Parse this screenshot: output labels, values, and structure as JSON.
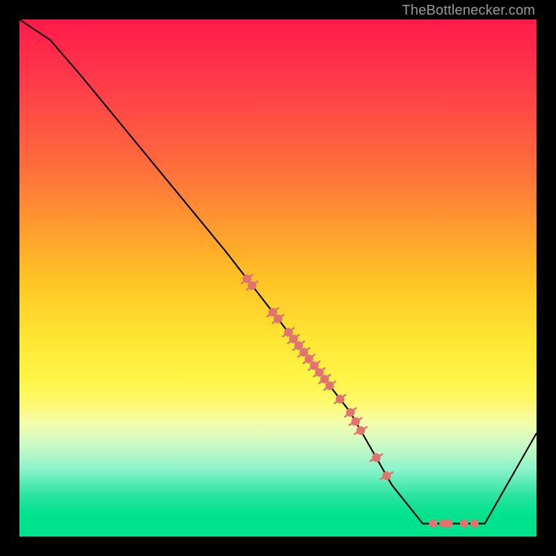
{
  "attribution": "TheBottlenecker.com",
  "chart_data": {
    "type": "line",
    "title": "",
    "xlabel": "",
    "ylabel": "",
    "xlim": [
      0,
      100
    ],
    "ylim": [
      0,
      100
    ],
    "curve": [
      {
        "x": 0,
        "y": 100
      },
      {
        "x": 6,
        "y": 96
      },
      {
        "x": 12,
        "y": 89
      },
      {
        "x": 40,
        "y": 55
      },
      {
        "x": 64,
        "y": 24
      },
      {
        "x": 72,
        "y": 10
      },
      {
        "x": 78,
        "y": 2.5
      },
      {
        "x": 90,
        "y": 2.5
      },
      {
        "x": 100,
        "y": 20
      }
    ],
    "markers_on_slope": [
      {
        "x": 44
      },
      {
        "x": 45
      },
      {
        "x": 49
      },
      {
        "x": 50
      },
      {
        "x": 52
      },
      {
        "x": 53
      },
      {
        "x": 54
      },
      {
        "x": 55
      },
      {
        "x": 56
      },
      {
        "x": 57
      },
      {
        "x": 58
      },
      {
        "x": 59
      },
      {
        "x": 60
      },
      {
        "x": 62
      },
      {
        "x": 64
      },
      {
        "x": 65
      },
      {
        "x": 66
      },
      {
        "x": 69
      },
      {
        "x": 71
      }
    ],
    "markers_on_valley": [
      {
        "x": 80
      },
      {
        "x": 82
      },
      {
        "x": 83
      },
      {
        "x": 86
      },
      {
        "x": 88
      }
    ]
  },
  "colors": {
    "marker": "#e3736f",
    "curve": "#000000"
  }
}
